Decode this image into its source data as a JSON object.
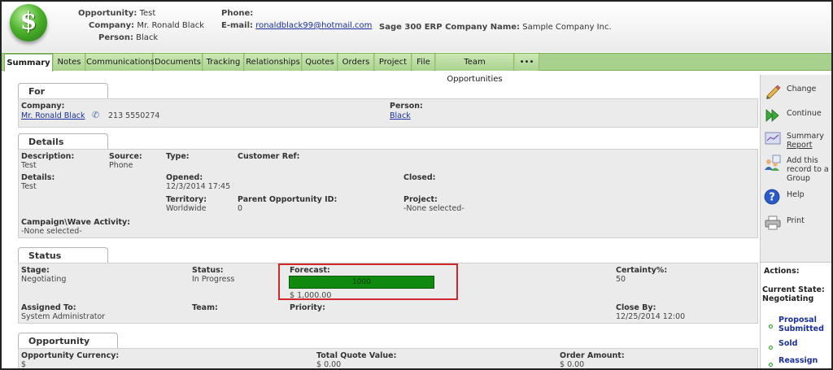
{
  "header": {
    "opportunity_label": "Opportunity:",
    "opportunity_value": "Test",
    "company_label": "Company:",
    "company_value": "Mr. Ronald Black",
    "person_label": "Person:",
    "person_value": "Black",
    "phone_label": "Phone:",
    "email_label": "E-mail:",
    "email_value": "ronaldblack99@hotmail.com",
    "erp_label": "Sage 300 ERP Company Name:",
    "erp_value": "Sample Company Inc.",
    "logo_glyph": "$"
  },
  "tabs": [
    "Summary",
    "Notes",
    "Communications",
    "Documents",
    "Tracking",
    "Relationships",
    "Quotes",
    "Orders",
    "Project",
    "File",
    "Team Opportunities",
    "•••"
  ],
  "for_panel": {
    "title": "For",
    "company_label": "Company:",
    "company_value": "Mr. Ronald Black",
    "phone_value": "213 5550274",
    "person_label": "Person:",
    "person_value": "Black"
  },
  "details_panel": {
    "title": "Details",
    "description_label": "Description:",
    "description_value": "Test",
    "source_label": "Source:",
    "source_value": "Phone",
    "type_label": "Type:",
    "customer_ref_label": "Customer Ref:",
    "details_label": "Details:",
    "details_value": "Test",
    "opened_label": "Opened:",
    "opened_value": "12/3/2014 17:45",
    "closed_label": "Closed:",
    "territory_label": "Territory:",
    "territory_value": "Worldwide",
    "parent_label": "Parent Opportunity ID:",
    "parent_value": "0",
    "project_label": "Project:",
    "project_value": "-None selected-",
    "campaign_label": "Campaign\\Wave Activity:",
    "campaign_value": "-None selected-"
  },
  "status_panel": {
    "title": "Status",
    "stage_label": "Stage:",
    "stage_value": "Negotiating",
    "status_label": "Status:",
    "status_value": "In Progress",
    "forecast_label": "Forecast:",
    "forecast_bar_value": "1000",
    "forecast_amount": "$ 1,000.00",
    "certainty_label": "Certainty%:",
    "certainty_value": "50",
    "assigned_label": "Assigned To:",
    "assigned_value": "System Administrator",
    "team_label": "Team:",
    "priority_label": "Priority:",
    "closeby_label": "Close By:",
    "closeby_value": "12/25/2014 12:00"
  },
  "total_panel": {
    "title": "Opportunity Total",
    "currency_label": "Opportunity Currency:",
    "currency_value": "$",
    "quote_label": "Total Quote Value:",
    "quote_value": "$ 0.00",
    "order_label": "Order Amount:",
    "order_value": "$ 0.00"
  },
  "sidebar": {
    "change": "Change",
    "continue": "Continue",
    "summary_report_1": "Summary",
    "summary_report_2": "Report",
    "add_group_1": "Add this",
    "add_group_2": "record to a",
    "add_group_3": "Group",
    "help": "Help",
    "print": "Print",
    "actions_label": "Actions:",
    "current_state_label": "Current State:",
    "current_state_value": "Negotiating",
    "action_items": [
      "Proposal",
      "Submitted",
      "Sold",
      "Reassign"
    ]
  },
  "colors": {
    "tab_green": "#a9d18e",
    "forecast_green": "#0f8a0f",
    "highlight_red": "#d22a2a",
    "link_blue": "#1a2fa0"
  }
}
